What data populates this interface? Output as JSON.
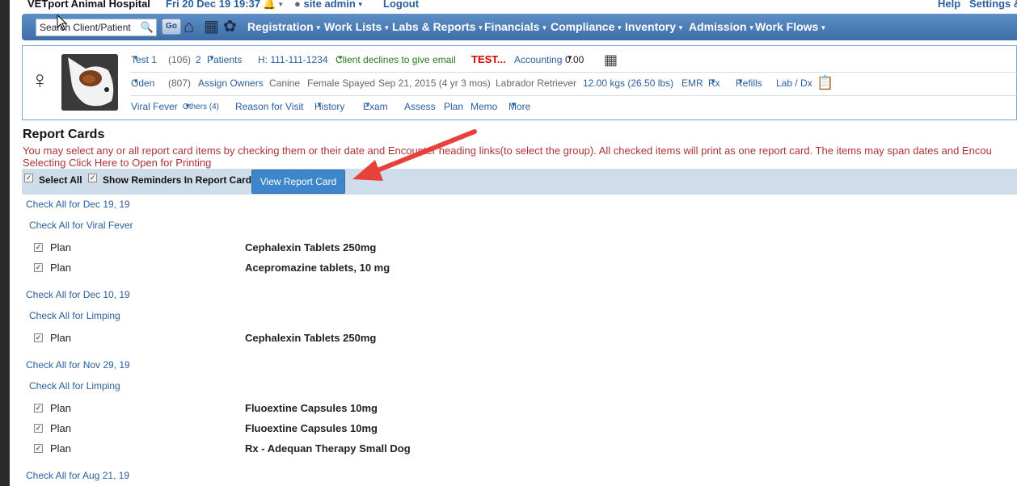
{
  "header": {
    "hospital": "VETport Animal Hospital",
    "datetime": "Fri 20 Dec 19 19:37",
    "user": "site admin",
    "logout": "Logout",
    "help": "Help",
    "settings": "Settings &"
  },
  "nav": {
    "search_value": "Search Client/Patient",
    "go": "Go",
    "menus": [
      "Registration",
      "Work Lists",
      "Labs & Reports",
      "Financials",
      "Compliance",
      "Inventory",
      "Admission",
      "Work Flows"
    ]
  },
  "patient": {
    "row1": {
      "client": "Test 1",
      "client_id": "(106)",
      "patients_count": "2",
      "patients_label": "Patients",
      "phone": "H: 111-111-1234",
      "email_note": "Client declines to give email",
      "flag": "TEST...",
      "accounting_label": "Accounting",
      "accounting_value": "0.00"
    },
    "row2": {
      "name": "Oden",
      "pid": "(807)",
      "assign": "Assign Owners",
      "species": "Canine",
      "sex": "Female Spayed",
      "dob": "Sep 21, 2015 (4 yr 3 mos)",
      "breed": "Labrador Retriever",
      "weight": "12.00 kgs (26.50 lbs)",
      "emr": "EMR",
      "rx": "Rx",
      "refills": "Refills",
      "labdx": "Lab / Dx"
    },
    "row3": {
      "problem": "Viral Fever",
      "others": "Others (4)",
      "reason": "Reason for Visit",
      "history": "History",
      "exam": "Exam",
      "assess": "Assess",
      "plan": "Plan",
      "memo": "Memo",
      "more": "More"
    }
  },
  "report": {
    "title": "Report Cards",
    "note1": "You may select any or all report card items by checking them or their date and Encounter heading links(to select the group). All checked items will print as one report card. The items may span dates and Encou",
    "note2": "Selecting Click Here to Open for Printing",
    "select_all": "Select All",
    "show_reminders": "Show Reminders In Report Card",
    "view_button": "View Report Card",
    "groups": [
      {
        "date": "Check All for Dec 19, 19",
        "encounter": "Check All for Viral Fever",
        "items": [
          {
            "type": "Plan",
            "name": "Cephalexin Tablets 250mg"
          },
          {
            "type": "Plan",
            "name": "Acepromazine tablets, 10 mg"
          }
        ]
      },
      {
        "date": "Check All for Dec 10, 19",
        "encounter": "Check All for Limping",
        "items": [
          {
            "type": "Plan",
            "name": "Cephalexin Tablets 250mg"
          }
        ]
      },
      {
        "date": "Check All for Nov 29, 19",
        "encounter": "Check All for Limping",
        "items": [
          {
            "type": "Plan",
            "name": "Fluoextine Capsules 10mg"
          },
          {
            "type": "Plan",
            "name": "Fluoextine Capsules 10mg"
          },
          {
            "type": "Plan",
            "name": "Rx - Adequan Therapy Small Dog"
          }
        ]
      },
      {
        "date": "Check All for Aug 21, 19"
      }
    ]
  },
  "colors": {
    "nav_bar": "#4a7cb8",
    "link": "#2a5e9c",
    "note_text": "#aa3333",
    "view_button": "#3d86c9",
    "arrow": "#e8403a"
  }
}
